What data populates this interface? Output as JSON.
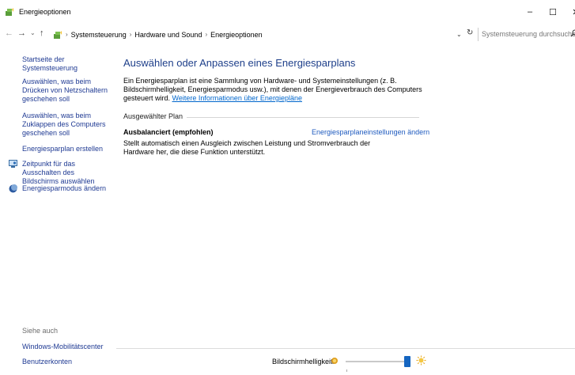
{
  "window": {
    "title": "Energieoptionen",
    "minimize_glyph": "–",
    "maximize_glyph": "☐",
    "close_glyph": "✕"
  },
  "nav": {
    "back_glyph": "←",
    "forward_glyph": "→",
    "history_glyph": "⌄",
    "up_glyph": "↑"
  },
  "address": {
    "crumbs": [
      "Systemsteuerung",
      "Hardware und Sound",
      "Energieoptionen"
    ],
    "separator": "›",
    "dropdown_glyph": "⌄",
    "refresh_glyph": "↻"
  },
  "search": {
    "placeholder": "Systemsteuerung durchsuchen",
    "icon": "search-icon"
  },
  "sidebar": {
    "items": [
      {
        "label": "Startseite der Systemsteuerung"
      },
      {
        "label": "Auswählen, was beim Drücken von Netzschaltern geschehen soll"
      },
      {
        "label": "Auswählen, was beim Zuklappen des Computers geschehen soll"
      },
      {
        "label": "Energiesparplan erstellen"
      },
      {
        "label": "Zeitpunkt für das Ausschalten des Bildschirms auswählen",
        "icon": "monitor-icon"
      },
      {
        "label": "Energiesparmodus ändern",
        "icon": "sleep-moon-icon"
      }
    ],
    "see_also": "Siehe auch",
    "bottom_links": [
      {
        "label": "Windows-Mobilitätscenter"
      },
      {
        "label": "Benutzerkonten"
      }
    ]
  },
  "main": {
    "title": "Auswählen oder Anpassen eines Energiesparplans",
    "description": "Ein Energiesparplan ist eine Sammlung von Hardware- und Systemeinstellungen (z. B. Bildschirmhelligkeit, Energiesparmodus usw.), mit denen der Energieverbrauch des Computers gesteuert wird.",
    "more_info_link": "Weitere Informationen über Energiepläne",
    "group_label": "Ausgewählter Plan",
    "plan": {
      "name": "Ausbalanciert (empfohlen)",
      "settings_link": "Energiesparplaneinstellungen ändern",
      "description": "Stellt automatisch einen Ausgleich zwischen Leistung und Stromverbrauch der Hardware her, die diese Funktion unterstützt."
    }
  },
  "brightness": {
    "label": "Bildschirmhelligkeit:",
    "value_percent": 100,
    "low_icon": "brightness-low-icon",
    "high_icon": "brightness-high-icon"
  },
  "colors": {
    "link": "#1f3a93",
    "title": "#1e3f8a",
    "accent": "#1565c0"
  }
}
